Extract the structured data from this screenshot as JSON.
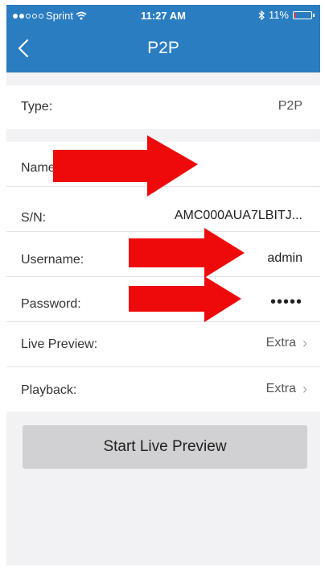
{
  "status_bar": {
    "carrier": "Sprint",
    "time": "11:27 AM",
    "battery": "11%",
    "battery_level": 0.11,
    "icons": [
      "signal-dots-icon",
      "wifi-icon",
      "bluetooth-icon",
      "battery-icon"
    ]
  },
  "nav": {
    "title": "P2P",
    "back_icon": "chevron-left-icon"
  },
  "device_form": {
    "type_label": "Type:",
    "type_value": "P2P",
    "name_label": "Name:",
    "sn_label": "S/N:",
    "sn_value": "AMC000AUA7LBITJ...",
    "username_label": "Username:",
    "username_value": "admin",
    "password_label": "Password:",
    "password_value": "•••••",
    "live_preview_label": "Live Preview:",
    "live_preview_value": "Extra",
    "playback_label": "Playback:",
    "playback_value": "Extra"
  },
  "actions": {
    "start_live_preview": "Start Live Preview"
  },
  "colors": {
    "header": "#2a7dc1",
    "arrow": "#ee0a0a",
    "button": "#d1d1d3",
    "background": "#f2f2f4"
  }
}
